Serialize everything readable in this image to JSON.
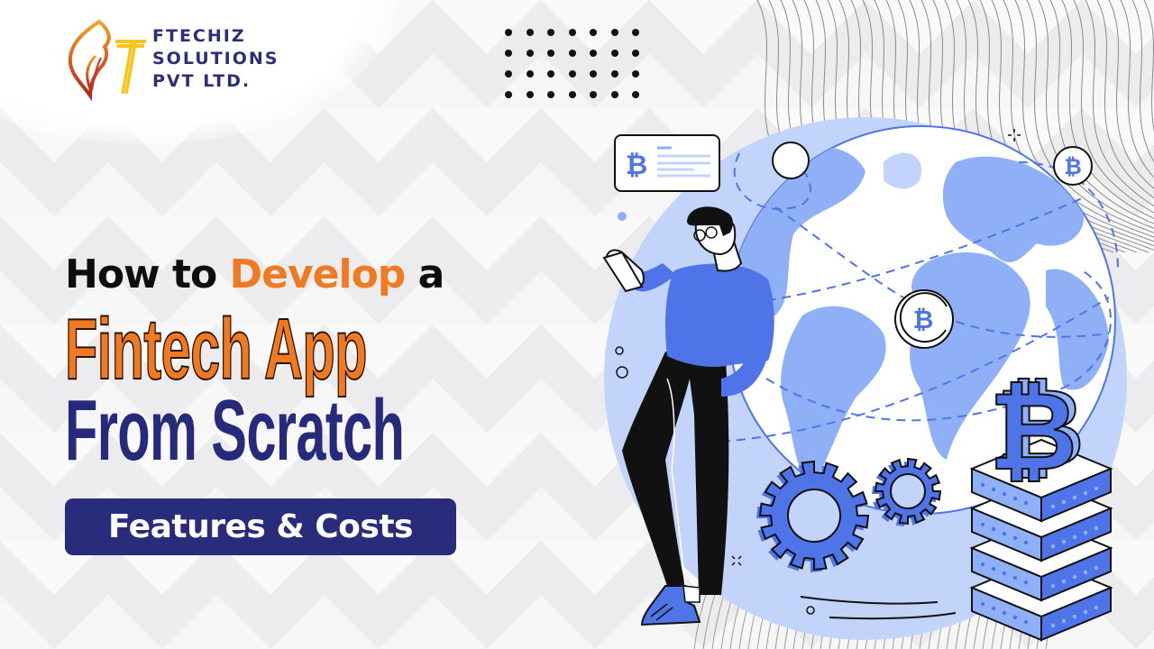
{
  "brand": {
    "name_line1": "FTECHIZ",
    "name_line2": "SOLUTIONS",
    "name_line3": "PVT LTD.",
    "colors": {
      "navy": "#2c2f78",
      "orange": "#ef7a22",
      "flame_red": "#c0392b",
      "flame_yellow": "#f5c518"
    }
  },
  "headline": {
    "line1_pre": "How to ",
    "line1_accent": "Develop",
    "line1_post": " a",
    "line2": "Fintech App",
    "line3": "From Scratch",
    "badge": "Features & Costs"
  },
  "illustration": {
    "card_icon": "bitcoin-icon",
    "coins": [
      "bitcoin-coin",
      "bitcoin-coin",
      "bitcoin-coin"
    ],
    "colors": {
      "primary_blue": "#4f74e8",
      "light_blue": "#c3d4fb",
      "mid_blue": "#8fb0f7",
      "dark": "#111111"
    }
  }
}
